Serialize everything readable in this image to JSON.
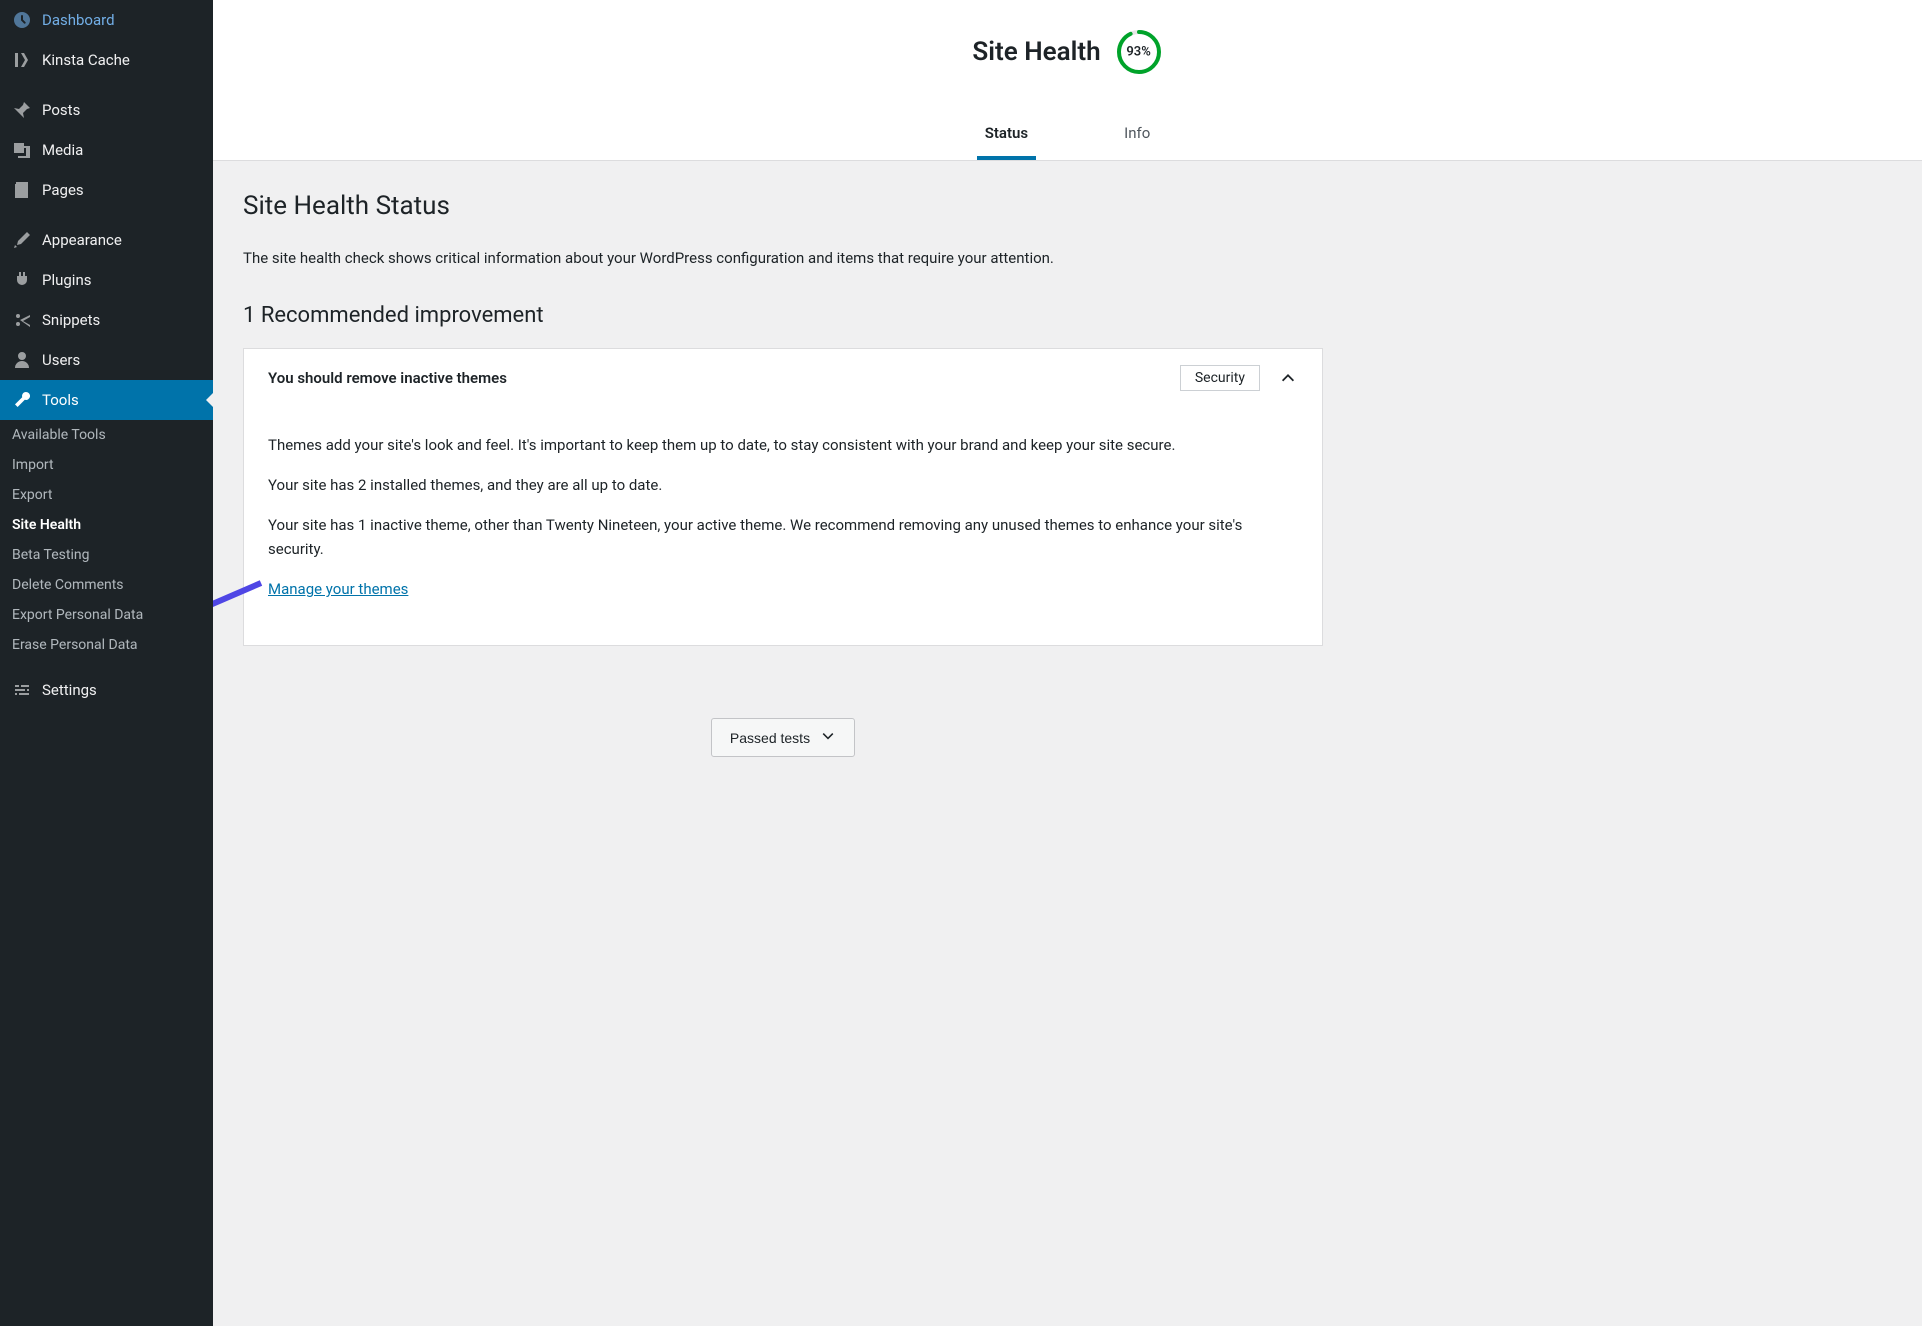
{
  "sidebar": {
    "items": [
      {
        "label": "Dashboard",
        "icon": "dashboard"
      },
      {
        "label": "Kinsta Cache",
        "icon": "kinsta"
      },
      {
        "separator": true
      },
      {
        "label": "Posts",
        "icon": "pin"
      },
      {
        "label": "Media",
        "icon": "media"
      },
      {
        "label": "Pages",
        "icon": "page"
      },
      {
        "separator": true
      },
      {
        "label": "Appearance",
        "icon": "brush"
      },
      {
        "label": "Plugins",
        "icon": "plugin"
      },
      {
        "label": "Snippets",
        "icon": "scissors"
      },
      {
        "label": "Users",
        "icon": "user"
      },
      {
        "label": "Tools",
        "icon": "wrench",
        "active": true
      },
      {
        "separator": true
      },
      {
        "label": "Settings",
        "icon": "settings"
      }
    ],
    "submenu": [
      {
        "label": "Available Tools"
      },
      {
        "label": "Import"
      },
      {
        "label": "Export"
      },
      {
        "label": "Site Health",
        "current": true
      },
      {
        "label": "Beta Testing"
      },
      {
        "label": "Delete Comments"
      },
      {
        "label": "Export Personal Data"
      },
      {
        "label": "Erase Personal Data"
      }
    ]
  },
  "header": {
    "title": "Site Health",
    "progress": "93%",
    "progress_value": 93
  },
  "tabs": {
    "status": "Status",
    "info": "Info"
  },
  "status": {
    "heading": "Site Health Status",
    "description": "The site health check shows critical information about your WordPress configuration and items that require your attention.",
    "rec_heading": "1 Recommended improvement"
  },
  "issue": {
    "title": "You should remove inactive themes",
    "badge": "Security",
    "p1": "Themes add your site's look and feel. It's important to keep them up to date, to stay consistent with your brand and keep your site secure.",
    "p2": "Your site has 2 installed themes, and they are all up to date.",
    "p3": "Your site has 1 inactive theme, other than Twenty Nineteen, your active theme. We recommend removing any unused themes to enhance your site's security.",
    "link": "Manage your themes"
  },
  "passed_label": "Passed tests"
}
